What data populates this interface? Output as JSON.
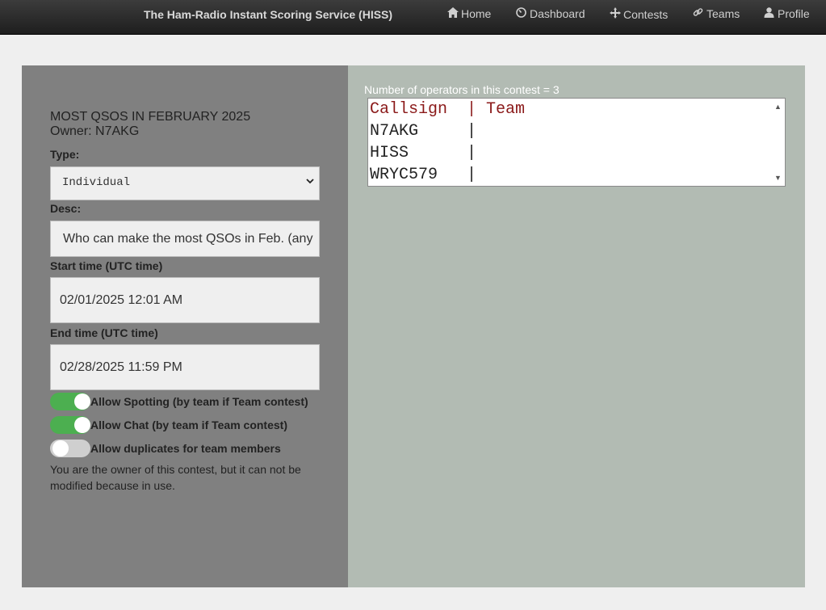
{
  "header": {
    "brand": "The Ham-Radio Instant Scoring Service (HISS)",
    "nav": [
      {
        "label": "Home",
        "icon": "home-icon"
      },
      {
        "label": "Dashboard",
        "icon": "dashboard-icon"
      },
      {
        "label": "Contests",
        "icon": "contests-icon"
      },
      {
        "label": "Teams",
        "icon": "link-icon"
      },
      {
        "label": "Profile",
        "icon": "user-icon"
      }
    ]
  },
  "contest": {
    "title": "MOST QSOS IN FEBRUARY 2025",
    "owner": "Owner: N7AKG",
    "type_label": "Type:",
    "type_value": "Individual",
    "desc_label": "Desc:",
    "desc_value": "Who can make the most QSOs in Feb. (any",
    "start_label": "Start time (UTC time)",
    "start_value": "02/01/2025 12:01 AM",
    "end_label": "End time (UTC time)",
    "end_value": "02/28/2025 11:59 PM",
    "toggles": [
      {
        "label": "Allow Spotting (by team if Team contest)",
        "on": true
      },
      {
        "label": "Allow Chat (by team if Team contest)",
        "on": true
      },
      {
        "label": "Allow duplicates for team members",
        "on": false
      }
    ],
    "note": "You are the owner of this contest, but it can not be modified because in use."
  },
  "operators": {
    "count_text": "Number of operators in this contest = 3",
    "header_row": "Callsign  | Team",
    "rows": [
      "N7AKG     |",
      "HISS      |",
      "WRYC579   |"
    ]
  },
  "colors": {
    "toggle_on": "#4caf50",
    "toggle_off": "#cfcfcf",
    "list_header": "#8b1a1a"
  }
}
